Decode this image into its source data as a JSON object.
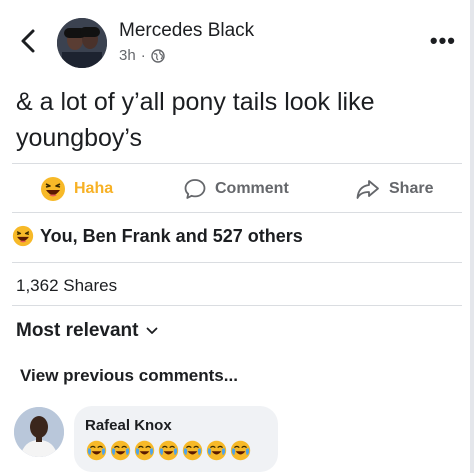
{
  "post": {
    "author": "Mercedes Black",
    "time": "3h",
    "separator": "·",
    "text": "& a lot of y’all pony tails look like youngboy’s"
  },
  "actions": {
    "haha": "Haha",
    "comment": "Comment",
    "share": "Share"
  },
  "reactions_summary": "You, Ben Frank and 527 others",
  "shares": "1,362 Shares",
  "sort": {
    "label": "Most relevant"
  },
  "view_previous": "View previous comments...",
  "comment": {
    "author": "Rafeal Knox",
    "emojis": [
      "crying-laughing",
      "crying-laughing",
      "crying-laughing",
      "crying-laughing",
      "crying-laughing",
      "crying-laughing",
      "crying-laughing"
    ]
  },
  "colors": {
    "haha_accent": "#f7b125",
    "secondary_text": "#65676b",
    "bubble": "#f0f2f5",
    "divider": "#dadde1"
  }
}
